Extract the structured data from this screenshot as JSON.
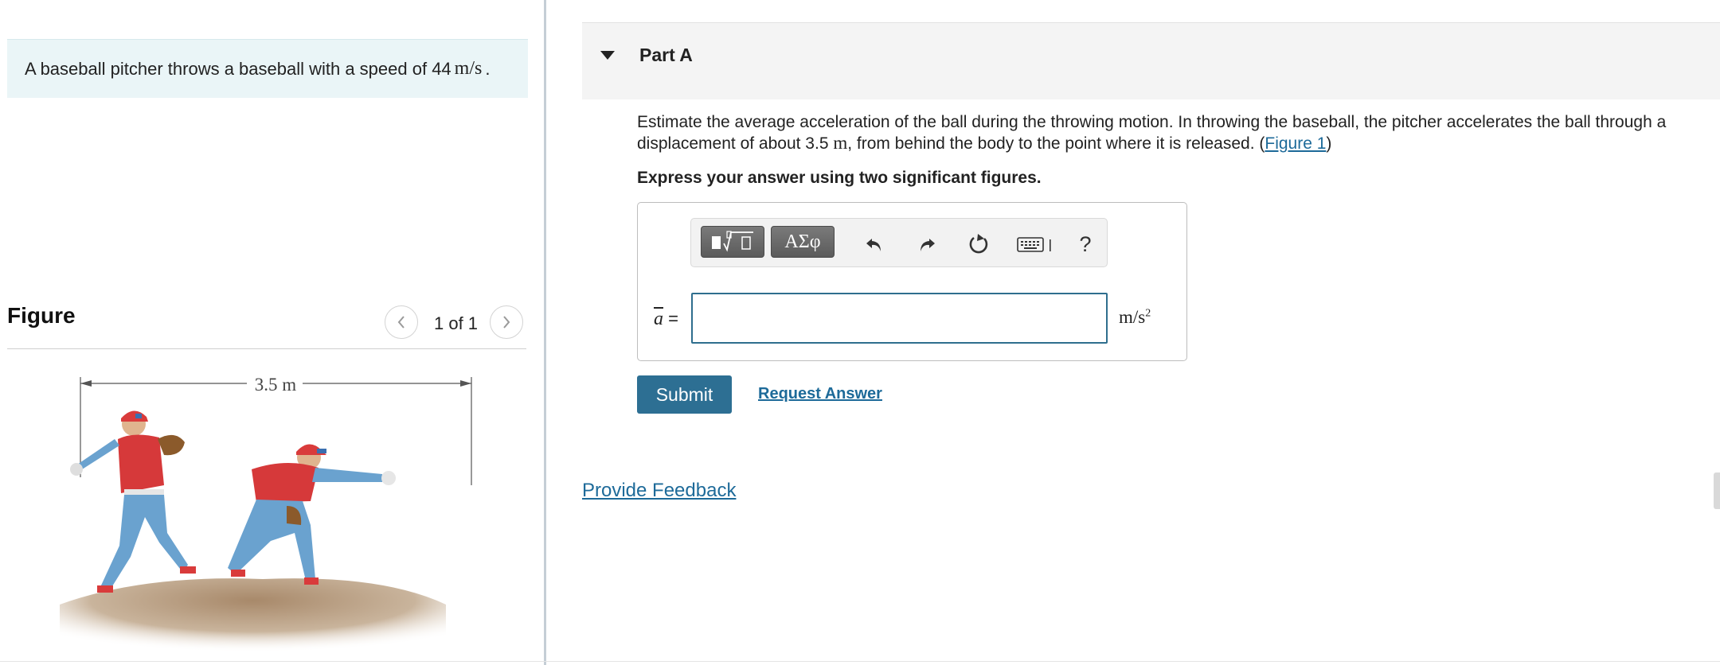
{
  "problem": {
    "text_before": "A baseball pitcher throws a baseball with a speed of 44",
    "unit": "m/s",
    "text_after": "."
  },
  "figure": {
    "title": "Figure",
    "page_indicator": "1 of 1",
    "prev_icon": "chevron-left-icon",
    "next_icon": "chevron-right-icon",
    "dimension_label": "3.5 m"
  },
  "part": {
    "title": "Part A",
    "question_line1": "Estimate the average acceleration of the ball during the throwing motion. In throwing the baseball, the pitcher accelerates the ball through a",
    "question_line2_before": "displacement of about 3.5",
    "question_unit": "m",
    "question_line2_after": ", from behind the body to the point where it is released. (",
    "figure_link": "Figure 1",
    "question_close": ")",
    "instruction": "Express your answer using two significant figures."
  },
  "toolbar": {
    "templates_icon": "math-templates-icon",
    "symbols_label": "ΑΣφ",
    "undo_icon": "undo-icon",
    "redo_icon": "redo-icon",
    "reset_icon": "reset-icon",
    "keyboard_icon": "keyboard-icon",
    "help_label": "?"
  },
  "answer": {
    "variable": "a",
    "equals": "=",
    "value": "",
    "unit_base": "m/s",
    "unit_exp": "2"
  },
  "actions": {
    "submit_label": "Submit",
    "request_answer_label": "Request Answer",
    "feedback_label": "Provide Feedback"
  },
  "colors": {
    "accent": "#2d6f93",
    "link": "#1d6a99",
    "problem_bg": "#eaf5f7",
    "part_header_bg": "#f4f4f4"
  }
}
